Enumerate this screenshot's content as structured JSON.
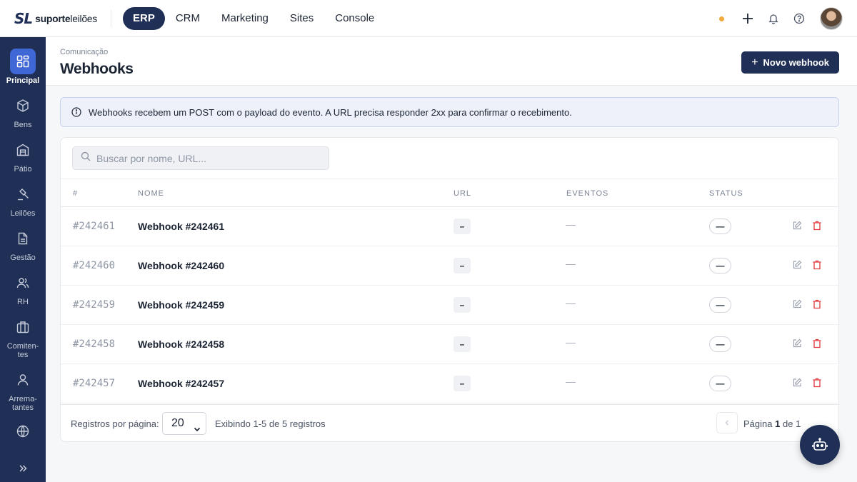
{
  "brand": {
    "mark": "SL",
    "name_bold": "suporte",
    "name_rest": "leilões"
  },
  "topnav": {
    "items": [
      {
        "label": "ERP",
        "active": true
      },
      {
        "label": "CRM",
        "active": false
      },
      {
        "label": "Marketing",
        "active": false
      },
      {
        "label": "Sites",
        "active": false
      },
      {
        "label": "Console",
        "active": false
      }
    ],
    "status_dot_color": "#f2a93b"
  },
  "sidebar": {
    "items": [
      {
        "label": "Principal",
        "icon": "grid-icon",
        "active": true
      },
      {
        "label": "Bens",
        "icon": "box-icon"
      },
      {
        "label": "Pátio",
        "icon": "warehouse-icon"
      },
      {
        "label": "Leilões",
        "icon": "gavel-icon"
      },
      {
        "label": "Gestão",
        "icon": "document-icon"
      },
      {
        "label": "RH",
        "icon": "users-icon"
      },
      {
        "label": "Comiten-\ntes",
        "icon": "briefcase-icon"
      },
      {
        "label": "Arrema-\ntantes",
        "icon": "user-icon"
      },
      {
        "label": "",
        "icon": "globe-icon"
      }
    ],
    "expand_icon": "double-chevron-right-icon"
  },
  "header": {
    "breadcrumb": "Comunicação",
    "title": "Webhooks",
    "new_button": "Novo webhook"
  },
  "info_banner": "Webhooks recebem um POST com o payload do evento. A URL precisa responder 2xx para confirmar o recebimento.",
  "search": {
    "placeholder": "Buscar por nome, URL..."
  },
  "table": {
    "columns": [
      "#",
      "Nome",
      "URL",
      "Eventos",
      "Status"
    ],
    "rows": [
      {
        "id": "#242461",
        "name": "Webhook #242461",
        "url": "–",
        "events": "—",
        "status": "—"
      },
      {
        "id": "#242460",
        "name": "Webhook #242460",
        "url": "–",
        "events": "—",
        "status": "—"
      },
      {
        "id": "#242459",
        "name": "Webhook #242459",
        "url": "–",
        "events": "—",
        "status": "—"
      },
      {
        "id": "#242458",
        "name": "Webhook #242458",
        "url": "–",
        "events": "—",
        "status": "—"
      },
      {
        "id": "#242457",
        "name": "Webhook #242457",
        "url": "–",
        "events": "—",
        "status": "—"
      }
    ]
  },
  "footer": {
    "per_page_label": "Registros por página:",
    "per_page_value": "20",
    "showing": "Exibindo 1-5 de 5 registros",
    "page_label": "Página",
    "page_current": "1",
    "page_of": "de",
    "page_total": "1"
  },
  "colors": {
    "navy": "#1f2f55",
    "accent_blue": "#3f67d6",
    "danger": "#e0393e"
  }
}
